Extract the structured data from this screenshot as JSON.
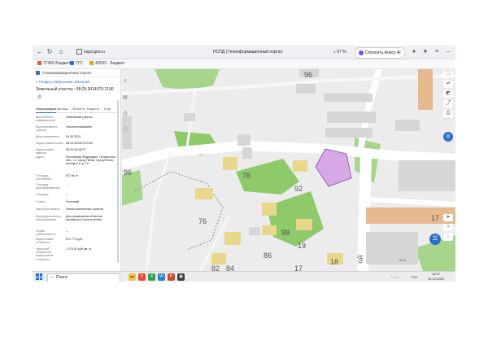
{
  "browser": {
    "url": "nspd.gov.ru",
    "tab_title": "НСПД | Геоинформационный портал",
    "zoom": "67 %",
    "alice_label": "Спросить Алису AI"
  },
  "bookmarks": [
    {
      "label": "77456 Бюджет",
      "color": "#e85c2c"
    },
    {
      "label": "ГГС",
      "color": "#2f6bd3"
    },
    {
      "label": "45532 · Бюджет",
      "color": "#e0a020"
    }
  ],
  "panel": {
    "header": "Геоинформационный портал",
    "back_link": "< Назад к найденным объектам",
    "title": "Земельный участок : 58:29:3014070:2190",
    "tabs": [
      "Информация",
      "Границы",
      "Объекты",
      "Кадастр",
      "Ещё"
    ],
    "rows": [
      {
        "k": "Вид объекта недвижимости",
        "v": "Земельный участок"
      },
      {
        "k": "Вид земельного участка",
        "v": "Землепользование"
      },
      {
        "k": "Дата присвоения",
        "v": "05.09.2024"
      },
      {
        "k": "Кадастровый номер",
        "v": "58:29:3014070:2190"
      },
      {
        "k": "Кадастровый квартал",
        "v": "58:29:3014070"
      },
      {
        "k": "Адрес",
        "v": "Российская Федерация, Пензенская обл., г.о. город Пенза, город Пенза, проезд 2-й, д. 12"
      },
      {
        "k": "Площадь уточненная",
        "v": "872 кв. м"
      },
      {
        "k": "Площадь декларированная",
        "v": "–"
      },
      {
        "k": "Площадь",
        "v": "–"
      },
      {
        "k": "Статус",
        "v": "Учтенный"
      },
      {
        "k": "Категория земель",
        "v": "Земли населенных пунктов"
      },
      {
        "k": "Вид разрешенного использования",
        "v": "Для размещения объектов жилищного строительства"
      },
      {
        "k": "Форма собственности",
        "v": "–"
      },
      {
        "k": "Кадастровая стоимость",
        "v": "872 773 руб."
      },
      {
        "k": "Удельный показатель кадастровой стоимости",
        "v": "1 470,42 руб./кв. м"
      }
    ]
  },
  "map": {
    "labels": [
      {
        "text": "96"
      },
      {
        "text": "96"
      },
      {
        "text": "78"
      },
      {
        "text": "92"
      },
      {
        "text": "76"
      },
      {
        "text": "88"
      },
      {
        "text": "86"
      },
      {
        "text": "19"
      },
      {
        "text": "84"
      },
      {
        "text": "17"
      },
      {
        "text": "18"
      },
      {
        "text": "82"
      },
      {
        "text": "17"
      },
      {
        "text": "ой"
      }
    ],
    "scale": "100 м"
  },
  "taskbar": {
    "search_placeholder": "Поиск",
    "tray_lang": "РУС",
    "time": "10:37",
    "date": "12.12.2024"
  },
  "colors": {
    "building": "#d6d6d6",
    "green": "#8ec96a",
    "selected": "#d7a8e6",
    "orange": "#e6b98f",
    "road": "#ffffff"
  }
}
